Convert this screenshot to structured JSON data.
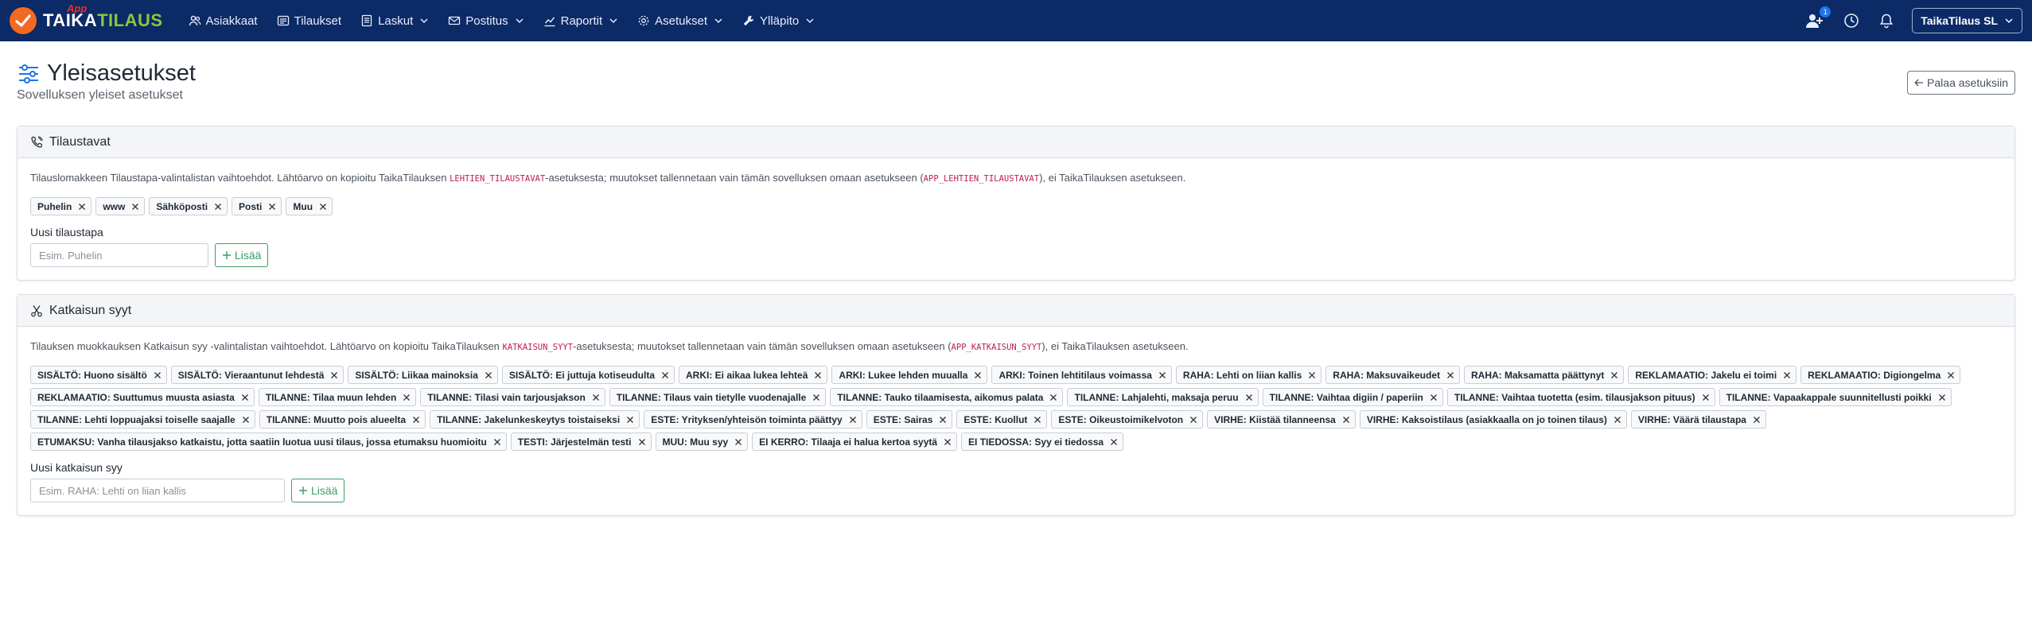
{
  "navbar": {
    "brand_app": "App",
    "brand_taika": "TAIKA",
    "brand_tilaus": "TILAUS",
    "items": [
      {
        "label": "Asiakkaat",
        "icon": "users-icon",
        "dropdown": false
      },
      {
        "label": "Tilaukset",
        "icon": "list-icon",
        "dropdown": false
      },
      {
        "label": "Laskut",
        "icon": "document-icon",
        "dropdown": true
      },
      {
        "label": "Postitus",
        "icon": "mail-icon",
        "dropdown": true
      },
      {
        "label": "Raportit",
        "icon": "chart-icon",
        "dropdown": true
      },
      {
        "label": "Asetukset",
        "icon": "gear-icon",
        "dropdown": true
      },
      {
        "label": "Ylläpito",
        "icon": "wrench-icon",
        "dropdown": true
      }
    ],
    "notification_count": "1",
    "account_label": "TaikaTilaus SL"
  },
  "page": {
    "title": "Yleisasetukset",
    "subtitle": "Sovelluksen yleiset asetukset",
    "back_label": "Palaa asetuksiin"
  },
  "tilaustavat": {
    "title": "Tilaustavat",
    "desc_1": "Tilauslomakkeen Tilaustapa-valintalistan vaihtoehdot. Lähtöarvo on kopioitu TaikaTilauksen ",
    "code_1": "LEHTIEN_TILAUSTAVAT",
    "desc_2": "-asetuksesta; muutokset tallennetaan vain tämän sovelluksen omaan asetukseen (",
    "code_2": "APP_LEHTIEN_TILAUSTAVAT",
    "desc_3": "), ei TaikaTilauksen asetukseen.",
    "chips": [
      "Puhelin",
      "www",
      "Sähköposti",
      "Posti",
      "Muu"
    ],
    "new_label": "Uusi tilaustapa",
    "placeholder": "Esim. Puhelin",
    "add_label": "Lisää"
  },
  "katkaisun_syyt": {
    "title": "Katkaisun syyt",
    "desc_1": "Tilauksen muokkauksen Katkaisun syy -valintalistan vaihtoehdot. Lähtöarvo on kopioitu TaikaTilauksen ",
    "code_1": "KATKAISUN_SYYT",
    "desc_2": "-asetuksesta; muutokset tallennetaan vain tämän sovelluksen omaan asetukseen (",
    "code_2": "APP_KATKAISUN_SYYT",
    "desc_3": "), ei TaikaTilauksen asetukseen.",
    "chips": [
      "SISÄLTÖ: Huono sisältö",
      "SISÄLTÖ: Vieraantunut lehdestä",
      "SISÄLTÖ: Liikaa mainoksia",
      "SISÄLTÖ: Ei juttuja kotiseudulta",
      "ARKI: Ei aikaa lukea lehteä",
      "ARKI: Lukee lehden muualla",
      "ARKI: Toinen lehtitilaus voimassa",
      "RAHA: Lehti on liian kallis",
      "RAHA: Maksuvaikeudet",
      "RAHA: Maksamatta päättynyt",
      "REKLAMAATIO: Jakelu ei toimi",
      "REKLAMAATIO: Digiongelma",
      "REKLAMAATIO: Suuttumus muusta asiasta",
      "TILANNE: Tilaa muun lehden",
      "TILANNE: Tilasi vain tarjousjakson",
      "TILANNE: Tilaus vain tietylle vuodenajalle",
      "TILANNE: Tauko tilaamisesta, aikomus palata",
      "TILANNE: Lahjalehti, maksaja peruu",
      "TILANNE: Vaihtaa digiin / paperiin",
      "TILANNE: Vaihtaa tuotetta (esim. tilausjakson pituus)",
      "TILANNE: Vapaakappale suunnitellusti poikki",
      "TILANNE: Lehti loppuajaksi toiselle saajalle",
      "TILANNE: Muutto pois alueelta",
      "TILANNE: Jakelunkeskeytys toistaiseksi",
      "ESTE: Yrityksen/yhteisön toiminta päättyy",
      "ESTE: Sairas",
      "ESTE: Kuollut",
      "ESTE: Oikeustoimikelvoton",
      "VIRHE: Kiistää tilanneensa",
      "VIRHE: Kaksoistilaus (asiakkaalla on jo toinen tilaus)",
      "VIRHE: Väärä tilaustapa",
      "ETUMAKSU: Vanha tilausjakso katkaistu, jotta saatiin luotua uusi tilaus, jossa etumaksu huomioitu",
      "TESTI: Järjestelmän testi",
      "MUU: Muu syy",
      "EI KERRO: Tilaaja ei halua kertoa syytä",
      "EI TIEDOSSA: Syy ei tiedossa"
    ],
    "new_label": "Uusi katkaisun syy",
    "placeholder": "Esim. RAHA: Lehti on liian kallis",
    "add_label": "Lisää"
  },
  "colors": {
    "navbar": "#0b2a66",
    "brand_orange": "#f26a21",
    "brand_green": "#8cc63f",
    "code_pink": "#c2185b",
    "add_green": "#3c9d64"
  }
}
